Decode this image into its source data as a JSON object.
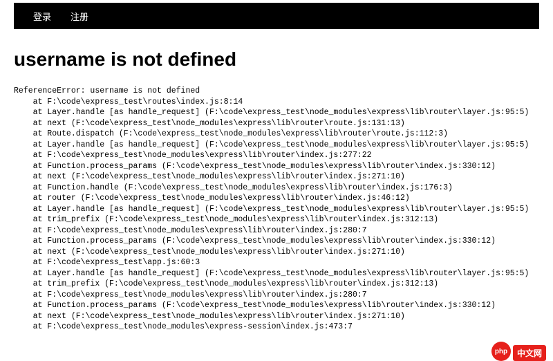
{
  "navbar": {
    "login": "登录",
    "register": "注册"
  },
  "error": {
    "title": "username is not defined",
    "header": "ReferenceError: username is not defined",
    "stack": [
      "    at F:\\code\\express_test\\routes\\index.js:8:14",
      "    at Layer.handle [as handle_request] (F:\\code\\express_test\\node_modules\\express\\lib\\router\\layer.js:95:5)",
      "    at next (F:\\code\\express_test\\node_modules\\express\\lib\\router\\route.js:131:13)",
      "    at Route.dispatch (F:\\code\\express_test\\node_modules\\express\\lib\\router\\route.js:112:3)",
      "    at Layer.handle [as handle_request] (F:\\code\\express_test\\node_modules\\express\\lib\\router\\layer.js:95:5)",
      "    at F:\\code\\express_test\\node_modules\\express\\lib\\router\\index.js:277:22",
      "    at Function.process_params (F:\\code\\express_test\\node_modules\\express\\lib\\router\\index.js:330:12)",
      "    at next (F:\\code\\express_test\\node_modules\\express\\lib\\router\\index.js:271:10)",
      "    at Function.handle (F:\\code\\express_test\\node_modules\\express\\lib\\router\\index.js:176:3)",
      "    at router (F:\\code\\express_test\\node_modules\\express\\lib\\router\\index.js:46:12)",
      "    at Layer.handle [as handle_request] (F:\\code\\express_test\\node_modules\\express\\lib\\router\\layer.js:95:5)",
      "    at trim_prefix (F:\\code\\express_test\\node_modules\\express\\lib\\router\\index.js:312:13)",
      "    at F:\\code\\express_test\\node_modules\\express\\lib\\router\\index.js:280:7",
      "    at Function.process_params (F:\\code\\express_test\\node_modules\\express\\lib\\router\\index.js:330:12)",
      "    at next (F:\\code\\express_test\\node_modules\\express\\lib\\router\\index.js:271:10)",
      "    at F:\\code\\express_test\\app.js:60:3",
      "    at Layer.handle [as handle_request] (F:\\code\\express_test\\node_modules\\express\\lib\\router\\layer.js:95:5)",
      "    at trim_prefix (F:\\code\\express_test\\node_modules\\express\\lib\\router\\index.js:312:13)",
      "    at F:\\code\\express_test\\node_modules\\express\\lib\\router\\index.js:280:7",
      "    at Function.process_params (F:\\code\\express_test\\node_modules\\express\\lib\\router\\index.js:330:12)",
      "    at next (F:\\code\\express_test\\node_modules\\express\\lib\\router\\index.js:271:10)",
      "    at F:\\code\\express_test\\node_modules\\express-session\\index.js:473:7"
    ]
  },
  "watermark": {
    "abbr": "php",
    "text": "中文网"
  }
}
